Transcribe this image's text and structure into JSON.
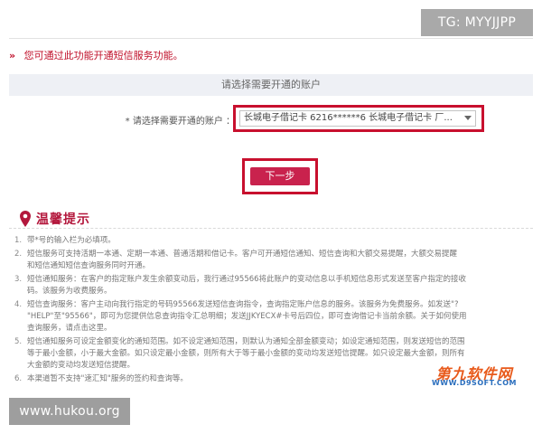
{
  "watermarks": {
    "top_right": "TG: MYYJJPP",
    "bottom_left": "www.hukou.org"
  },
  "notice": {
    "marker": "»",
    "text": "您可通过此功能开通短信服务功能。"
  },
  "account_section": {
    "header": "请选择需要开通的账户",
    "field_label": "* 请选择需要开通的账户 ：",
    "selected_value": "长城电子借记卡  6216******6      长城电子借记卡  厂..."
  },
  "actions": {
    "next_label": "下一步"
  },
  "tips": {
    "title": "温馨提示",
    "items": [
      {
        "num": "1.",
        "lines": [
          "带*号的输入栏为必填项。"
        ]
      },
      {
        "num": "2.",
        "lines": [
          "短信服务可支持活期一本通、定期一本通、普通活期和借记卡。客户可开通短信通知、短信查询和大额交易提醒，大额交易提醒",
          "和短信通知短信查询服务同时开通。"
        ]
      },
      {
        "num": "3.",
        "lines": [
          "短信通知服务：在客户的指定账户发生余额变动后，我行通过95566将此账户的变动信息以手机短信息形式发送至客户指定的接收",
          "码。该服务为收费服务。"
        ]
      },
      {
        "num": "4.",
        "lines": [
          "短信查询服务：客户主动向我行指定的号码95566发送短信查询指令，查询指定账户信息的服务。该服务为免费服务。如发送\"?",
          "\"HELP\"至\"95566\"，即可为您提供信息查询指令汇总明细；发送JJKYECX#卡号后四位，即可查询借记卡当前余额。关于如何使用",
          "查询服务，请点击这里。"
        ]
      },
      {
        "num": "5.",
        "lines": [
          "短信通知服务可设定金额变化的通知范围。如不设定通知范围，则默认为通知全部金额变动；如设定通知范围，则发送短信的范围",
          "等于最小金额，小于最大金额。如只设定最小金额，则所有大于等于最小金额的变动均发送短信提醒。如只设定最大金额，则所有",
          "大金额的变动均发送短信提醒。"
        ]
      },
      {
        "num": "6.",
        "lines": [
          "本渠道暂不支持\"速汇知\"服务的签约和查询等。"
        ]
      }
    ]
  },
  "logo": {
    "main": "第九软件网",
    "sub": "WWW.D9SOFT.COM"
  },
  "colors": {
    "accent_red": "#c8102e",
    "button_fill": "#c9224d",
    "tips_title": "#b3173c"
  }
}
